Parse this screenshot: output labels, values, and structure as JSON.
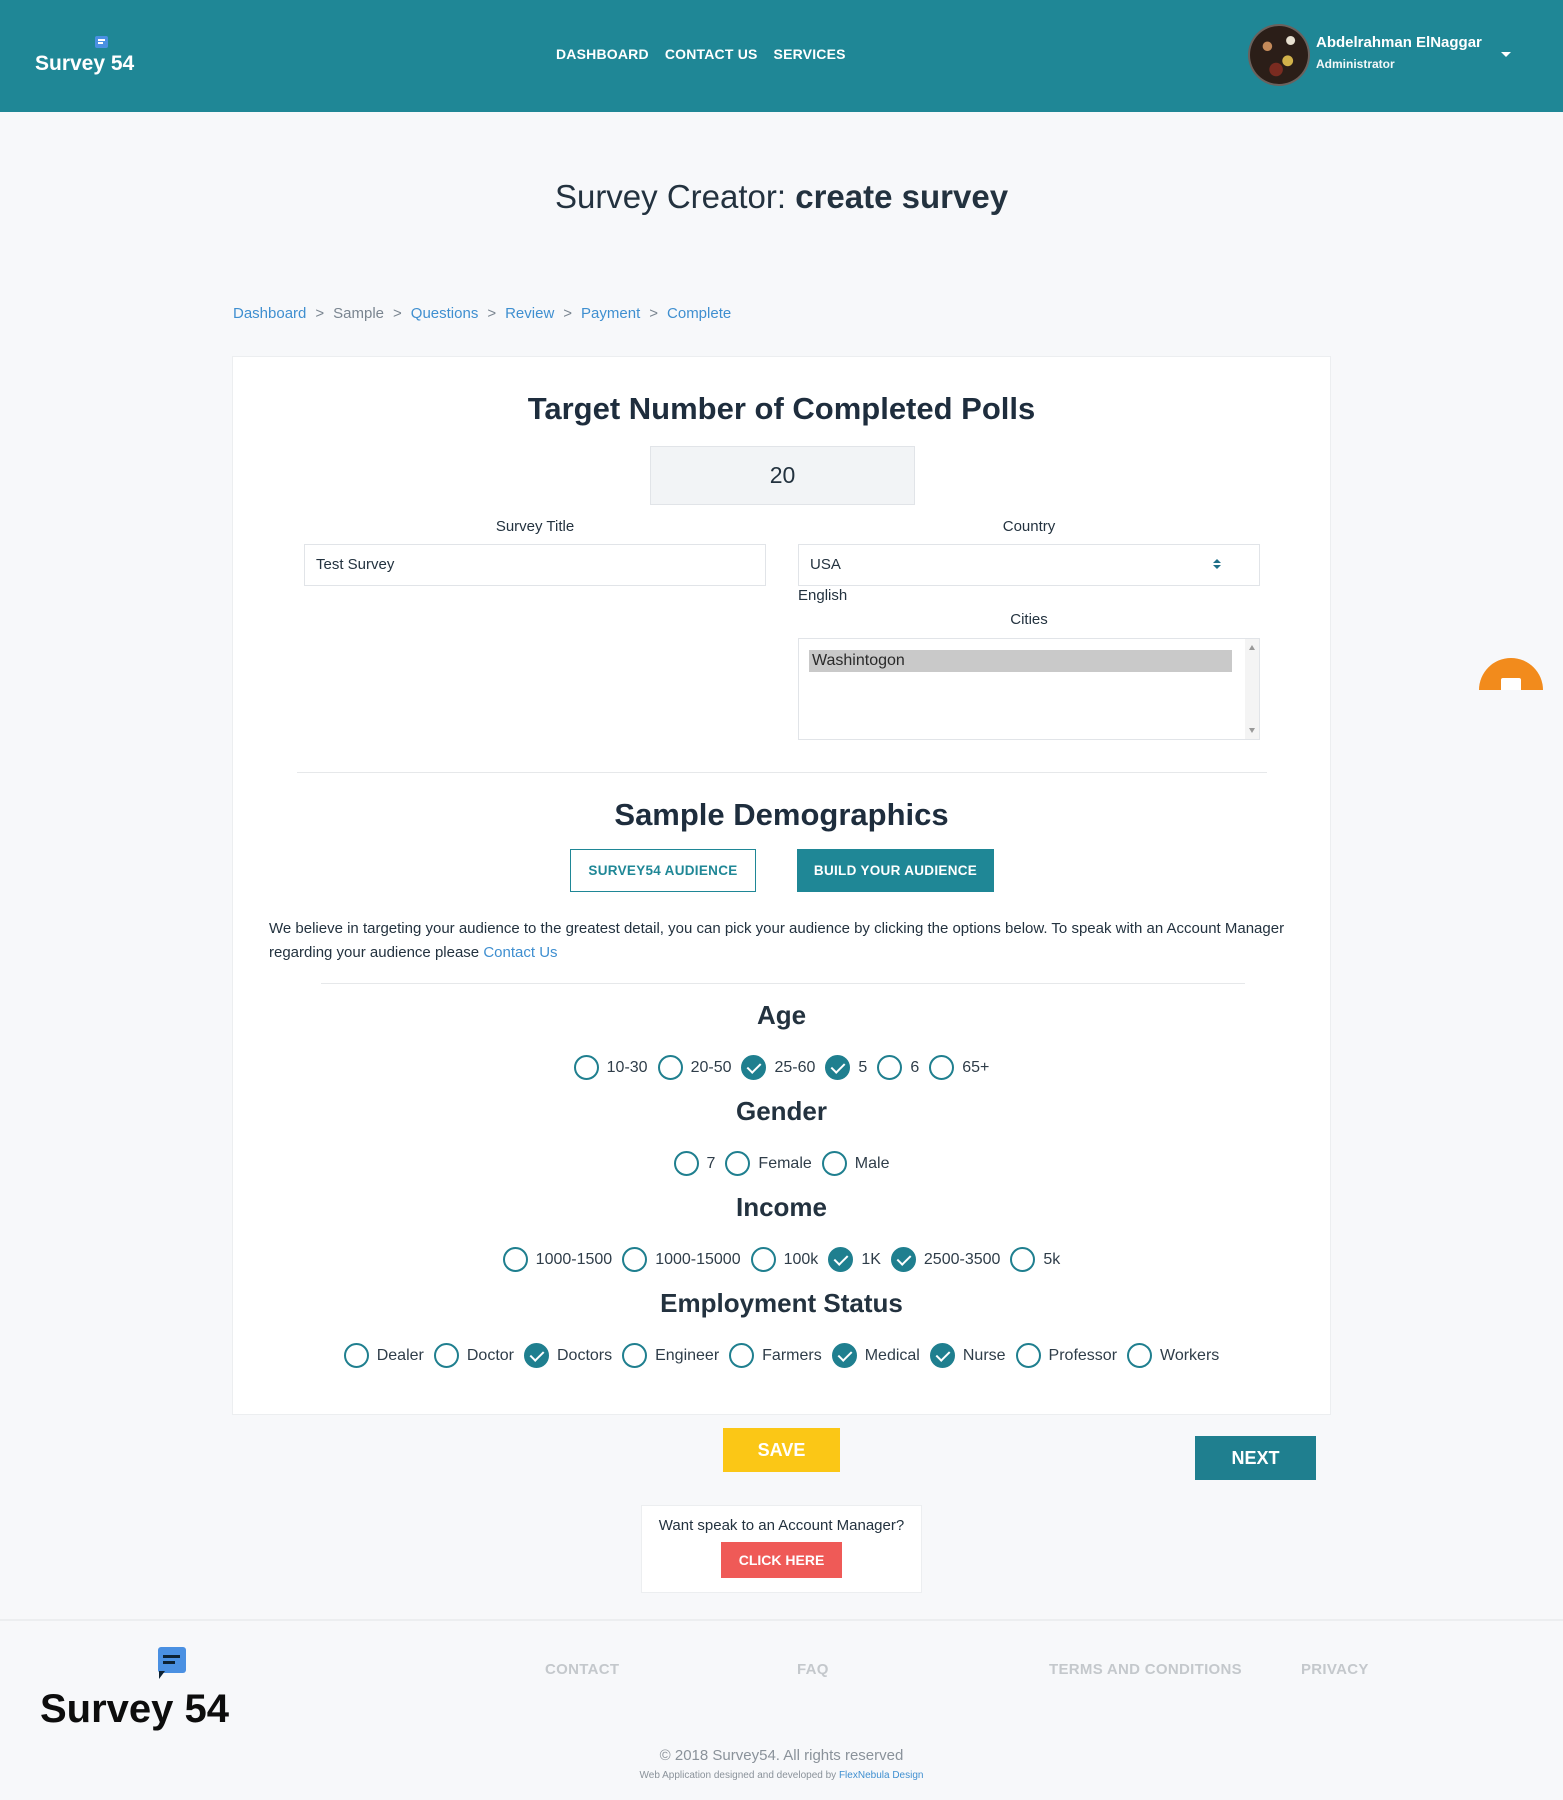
{
  "header": {
    "logo_text": "Survey 54",
    "nav": [
      "DASHBOARD",
      "CONTACT US",
      "SERVICES"
    ],
    "user": {
      "name": "Abdelrahman ElNaggar",
      "role": "Administrator"
    }
  },
  "page": {
    "title_prefix": "Survey Creator:",
    "title_bold": "create survey"
  },
  "breadcrumb": [
    {
      "label": "Dashboard",
      "active_link": true
    },
    {
      "label": "Sample",
      "active_link": false
    },
    {
      "label": "Questions",
      "active_link": true
    },
    {
      "label": "Review",
      "active_link": true
    },
    {
      "label": "Payment",
      "active_link": true
    },
    {
      "label": "Complete",
      "active_link": true
    }
  ],
  "breadcrumb_separator": ">",
  "form": {
    "target_heading": "Target Number of Completed Polls",
    "target_value": "20",
    "survey_title_label": "Survey Title",
    "survey_title_value": "Test Survey",
    "country_label": "Country",
    "country_value": "USA",
    "language": "English",
    "cities_label": "Cities",
    "cities": [
      "Washintogon"
    ]
  },
  "demographics": {
    "heading": "Sample Demographics",
    "audience_buttons": [
      "SURVEY54 AUDIENCE",
      "BUILD YOUR AUDIENCE"
    ],
    "blurb": "We believe in targeting your audience to the greatest detail, you can pick your audience by clicking the options below. To speak with an Account Manager regarding your audience please",
    "blurb_link": "Contact Us",
    "groups": [
      {
        "title": "Age",
        "options": [
          {
            "label": "10-30",
            "checked": false
          },
          {
            "label": "20-50",
            "checked": false
          },
          {
            "label": "25-60",
            "checked": true
          },
          {
            "label": "5",
            "checked": true
          },
          {
            "label": "6",
            "checked": false
          },
          {
            "label": "65+",
            "checked": false
          }
        ]
      },
      {
        "title": "Gender",
        "options": [
          {
            "label": "7",
            "checked": false
          },
          {
            "label": "Female",
            "checked": false
          },
          {
            "label": "Male",
            "checked": false
          }
        ]
      },
      {
        "title": "Income",
        "options": [
          {
            "label": "1000-1500",
            "checked": false
          },
          {
            "label": "1000-15000",
            "checked": false
          },
          {
            "label": "100k",
            "checked": false
          },
          {
            "label": "1K",
            "checked": true
          },
          {
            "label": "2500-3500",
            "checked": true
          },
          {
            "label": "5k",
            "checked": false
          }
        ]
      },
      {
        "title": "Employment Status",
        "options": [
          {
            "label": "Dealer",
            "checked": false
          },
          {
            "label": "Doctor",
            "checked": false
          },
          {
            "label": "Doctors",
            "checked": true
          },
          {
            "label": "Engineer",
            "checked": false
          },
          {
            "label": "Farmers",
            "checked": false
          },
          {
            "label": "Medical",
            "checked": true
          },
          {
            "label": "Nurse",
            "checked": true
          },
          {
            "label": "Professor",
            "checked": false
          },
          {
            "label": "Workers",
            "checked": false
          }
        ]
      }
    ]
  },
  "actions": {
    "save": "SAVE",
    "next": "NEXT",
    "manager_question": "Want speak to an Account Manager?",
    "click_here": "CLICK HERE"
  },
  "footer": {
    "logo_text": "Survey 54",
    "links": [
      "CONTACT",
      "FAQ",
      "TERMS AND CONDITIONS",
      "PRIVACY"
    ],
    "copyright": "© 2018 Survey54. All rights reserved",
    "credit_prefix": "Web Application designed and developed by",
    "credit_link": "FlexNebula Design"
  },
  "colors": {
    "brand_teal": "#1f8796",
    "save_yellow": "#fbc716",
    "click_red": "#ef5a57",
    "link_blue": "#3f8fd0",
    "widget_orange": "#f28b1c"
  }
}
